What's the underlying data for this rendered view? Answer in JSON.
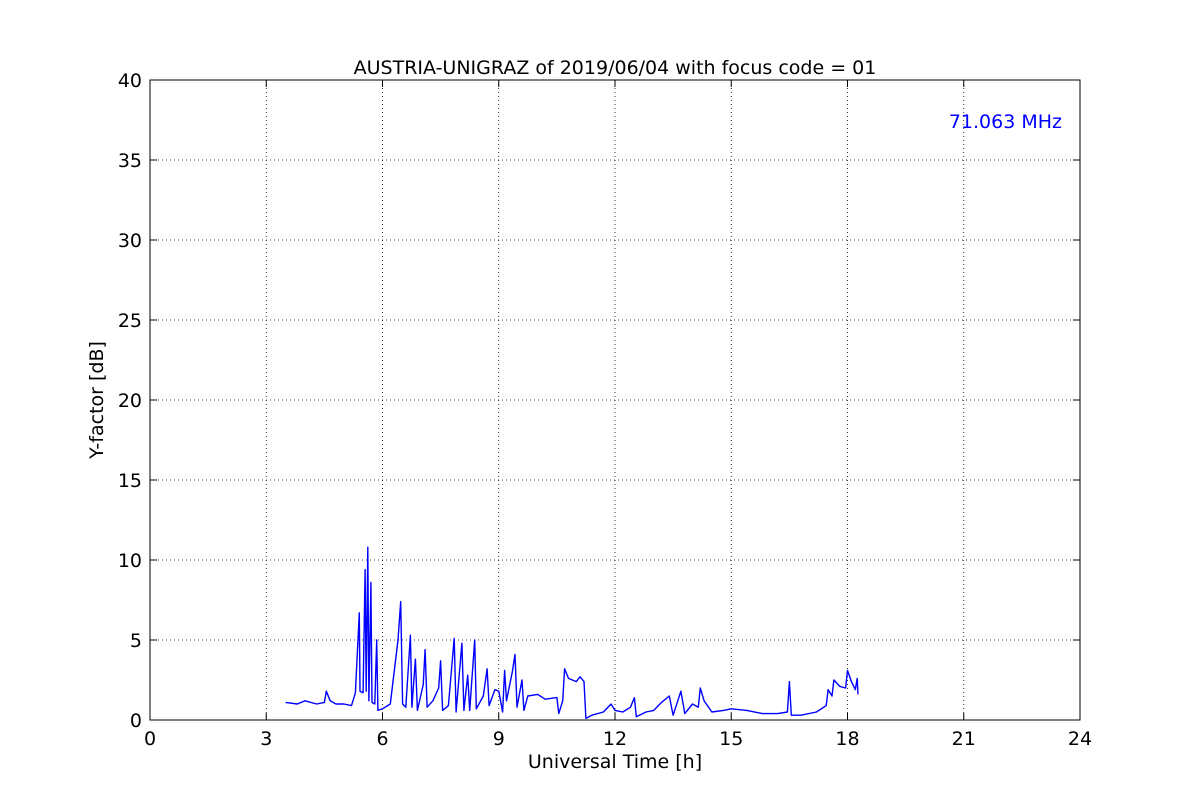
{
  "chart_data": {
    "type": "line",
    "title": "AUSTRIA-UNIGRAZ of 2019/06/04 with focus code = 01",
    "xlabel": "Universal Time [h]",
    "ylabel": "Y-factor [dB]",
    "xlim": [
      0,
      24
    ],
    "ylim": [
      0,
      40
    ],
    "xticks": [
      "0",
      "3",
      "6",
      "9",
      "12",
      "15",
      "18",
      "21",
      "24"
    ],
    "yticks": [
      "0",
      "5",
      "10",
      "15",
      "20",
      "25",
      "30",
      "35",
      "40"
    ],
    "grid": true,
    "annotation": {
      "text": "71.063 MHz",
      "color": "#0000ff",
      "placement": "top-right"
    },
    "series": [
      {
        "color": "#0000ff",
        "points": [
          [
            3.5,
            1.1
          ],
          [
            3.8,
            1.0
          ],
          [
            4.0,
            1.2
          ],
          [
            4.3,
            1.0
          ],
          [
            4.5,
            1.1
          ],
          [
            4.55,
            1.8
          ],
          [
            4.65,
            1.2
          ],
          [
            4.8,
            1.0
          ],
          [
            5.0,
            1.0
          ],
          [
            5.2,
            0.9
          ],
          [
            5.3,
            1.7
          ],
          [
            5.4,
            6.7
          ],
          [
            5.42,
            1.8
          ],
          [
            5.5,
            1.7
          ],
          [
            5.55,
            9.4
          ],
          [
            5.58,
            1.8
          ],
          [
            5.62,
            10.8
          ],
          [
            5.65,
            1.2
          ],
          [
            5.7,
            8.6
          ],
          [
            5.73,
            1.1
          ],
          [
            5.8,
            1.0
          ],
          [
            5.85,
            5.0
          ],
          [
            5.88,
            0.6
          ],
          [
            6.0,
            0.7
          ],
          [
            6.2,
            1.0
          ],
          [
            6.4,
            5.0
          ],
          [
            6.47,
            7.4
          ],
          [
            6.52,
            1.0
          ],
          [
            6.6,
            0.8
          ],
          [
            6.72,
            5.3
          ],
          [
            6.76,
            0.8
          ],
          [
            6.85,
            3.8
          ],
          [
            6.9,
            0.6
          ],
          [
            7.05,
            2.2
          ],
          [
            7.1,
            4.4
          ],
          [
            7.15,
            0.8
          ],
          [
            7.3,
            1.2
          ],
          [
            7.45,
            2.0
          ],
          [
            7.5,
            3.7
          ],
          [
            7.55,
            0.6
          ],
          [
            7.7,
            0.9
          ],
          [
            7.85,
            5.1
          ],
          [
            7.9,
            0.5
          ],
          [
            8.05,
            4.8
          ],
          [
            8.1,
            0.6
          ],
          [
            8.2,
            2.8
          ],
          [
            8.25,
            0.6
          ],
          [
            8.38,
            5.0
          ],
          [
            8.42,
            0.7
          ],
          [
            8.6,
            1.5
          ],
          [
            8.7,
            3.2
          ],
          [
            8.75,
            0.9
          ],
          [
            8.9,
            1.9
          ],
          [
            9.0,
            1.8
          ],
          [
            9.1,
            0.5
          ],
          [
            9.15,
            3.1
          ],
          [
            9.2,
            1.2
          ],
          [
            9.35,
            3.0
          ],
          [
            9.42,
            4.1
          ],
          [
            9.47,
            0.8
          ],
          [
            9.6,
            2.5
          ],
          [
            9.65,
            0.6
          ],
          [
            9.75,
            1.5
          ],
          [
            10.0,
            1.6
          ],
          [
            10.2,
            1.3
          ],
          [
            10.5,
            1.4
          ],
          [
            10.55,
            0.4
          ],
          [
            10.65,
            1.2
          ],
          [
            10.7,
            3.2
          ],
          [
            10.8,
            2.6
          ],
          [
            11.0,
            2.4
          ],
          [
            11.1,
            2.7
          ],
          [
            11.2,
            2.4
          ],
          [
            11.25,
            0.1
          ],
          [
            11.4,
            0.3
          ],
          [
            11.7,
            0.5
          ],
          [
            11.9,
            1.0
          ],
          [
            12.0,
            0.6
          ],
          [
            12.2,
            0.5
          ],
          [
            12.4,
            0.8
          ],
          [
            12.5,
            1.4
          ],
          [
            12.55,
            0.2
          ],
          [
            12.8,
            0.5
          ],
          [
            13.0,
            0.6
          ],
          [
            13.2,
            1.1
          ],
          [
            13.4,
            1.5
          ],
          [
            13.5,
            0.3
          ],
          [
            13.7,
            1.8
          ],
          [
            13.8,
            0.4
          ],
          [
            14.0,
            1.0
          ],
          [
            14.15,
            0.8
          ],
          [
            14.2,
            2.0
          ],
          [
            14.3,
            1.2
          ],
          [
            14.5,
            0.5
          ],
          [
            14.8,
            0.6
          ],
          [
            15.0,
            0.7
          ],
          [
            15.4,
            0.6
          ],
          [
            15.8,
            0.4
          ],
          [
            16.2,
            0.4
          ],
          [
            16.45,
            0.5
          ],
          [
            16.5,
            2.4
          ],
          [
            16.55,
            0.3
          ],
          [
            16.8,
            0.3
          ],
          [
            17.2,
            0.5
          ],
          [
            17.45,
            0.9
          ],
          [
            17.5,
            1.9
          ],
          [
            17.6,
            1.5
          ],
          [
            17.65,
            2.5
          ],
          [
            17.8,
            2.1
          ],
          [
            17.95,
            2.0
          ],
          [
            18.0,
            3.1
          ],
          [
            18.1,
            2.4
          ],
          [
            18.2,
            1.9
          ],
          [
            18.25,
            2.6
          ],
          [
            18.27,
            1.6
          ]
        ]
      }
    ]
  }
}
